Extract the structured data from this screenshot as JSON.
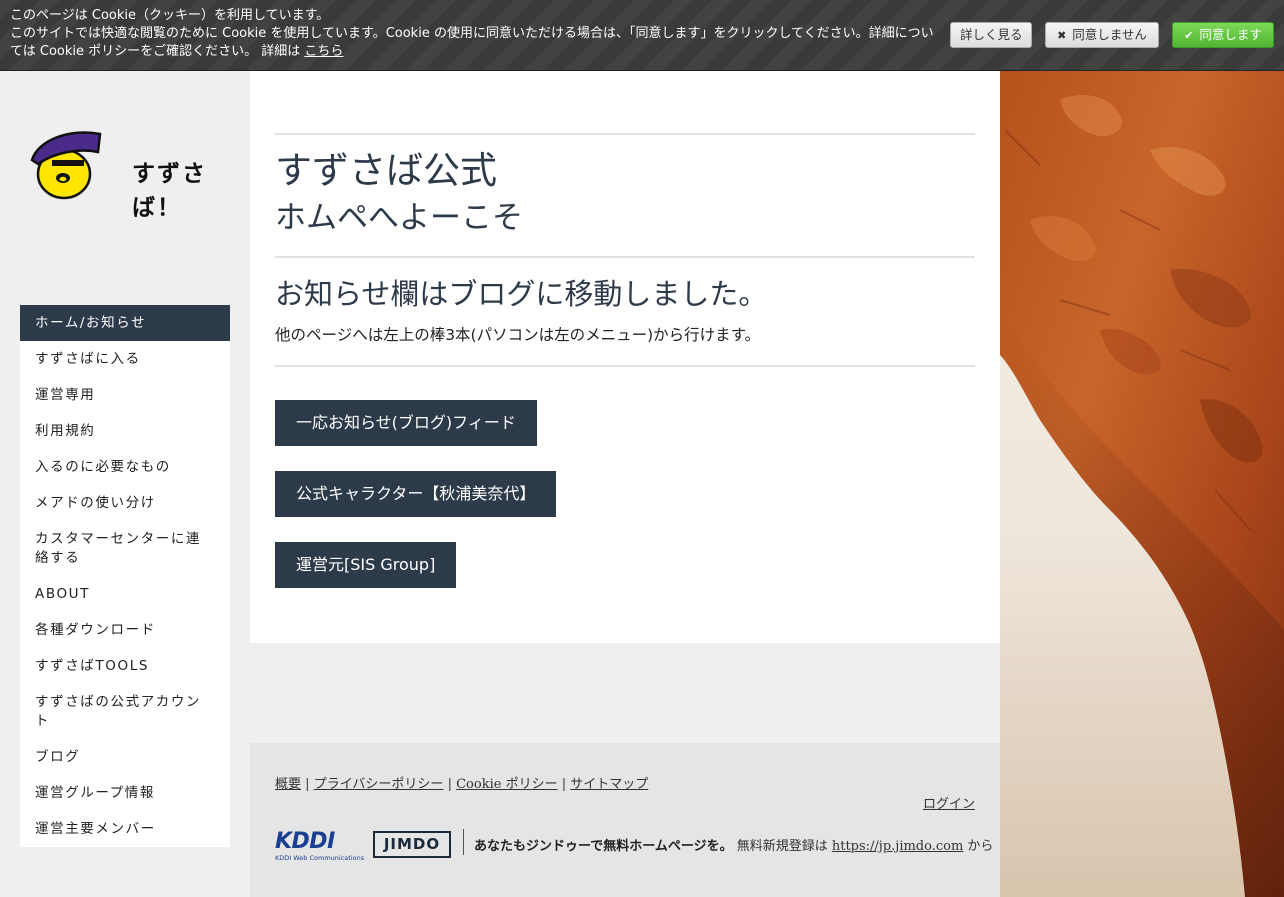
{
  "cookie": {
    "line1": "このページは Cookie（クッキー）を利用しています。",
    "line2": "このサイトでは快適な閲覧のために Cookie を使用しています。Cookie の使用に同意いただける場合は、「同意します」をクリックしてください。詳細については Cookie ポリシーをご確認ください。 詳細は",
    "link": "こちら",
    "more_label": "詳しく見る",
    "deny_label": "同意しません",
    "accept_label": "同意します",
    "deny_icon": "x-icon",
    "accept_icon": "check-icon"
  },
  "logo": {
    "text": "すずさば！"
  },
  "nav": {
    "items": [
      {
        "label": "ホーム/お知らせ",
        "active": true
      },
      {
        "label": "すずさばに入る"
      },
      {
        "label": "運営専用"
      },
      {
        "label": "利用規約"
      },
      {
        "label": "入るのに必要なもの"
      },
      {
        "label": "メアドの使い分け"
      },
      {
        "label": "カスタマーセンターに連絡する"
      },
      {
        "label": "ABOUT"
      },
      {
        "label": "各種ダウンロード"
      },
      {
        "label": "すずさばTOOLS"
      },
      {
        "label": "すずさばの公式アカウント"
      },
      {
        "label": "ブログ"
      },
      {
        "label": "運営グループ情報"
      },
      {
        "label": "運営主要メンバー"
      }
    ]
  },
  "main": {
    "title": "すずさば公式",
    "subtitle": "ホムペへよーこそ",
    "notice_heading": "お知らせ欄はブログに移動しました。",
    "notice_text": "他のページへは左上の棒3本(パソコンは左のメニュー)から行けます。",
    "buttons": [
      "一応お知らせ(ブログ)フィード",
      "公式キャラクター【秋浦美奈代】",
      "運営元[SIS Group]"
    ]
  },
  "footer": {
    "links": [
      "概要",
      "プライバシーポリシー",
      "Cookie ポリシー",
      "サイトマップ"
    ],
    "separator": "|",
    "login": "ログイン",
    "kddi_logo": "KDDI",
    "kddi_sub": "KDDI Web Communications",
    "jimdo_logo": "JIMDO",
    "promo_bold": "あなたもジンドゥーで無料ホームページを。",
    "promo_text": " 無料新規登録は ",
    "promo_link": "https://jp.jimdo.com",
    "promo_suffix": " から"
  },
  "colors": {
    "accent_dark": "#2d3a4a",
    "accept_green": "#5cc13a",
    "cookie_bar": "#3a3a3a"
  }
}
